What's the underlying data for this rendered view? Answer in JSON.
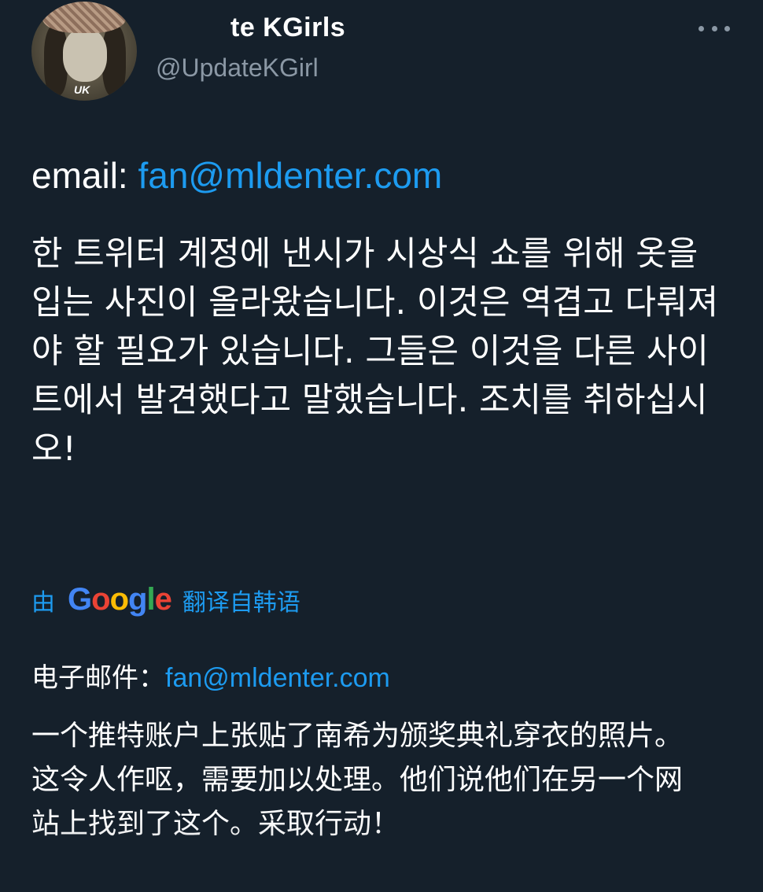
{
  "tweet": {
    "display_name": "te KGirls",
    "handle": "@UpdateKGirl",
    "avatar_mark": "UK",
    "more_icon": "more-horizontal-icon",
    "email_label": "email: ",
    "email_address": "fan@mldenter.com",
    "body_korean": "한 트위터 계정에 낸시가 시상식 쇼를 위해 옷을 입는 사진이 올라왔습니다. 이것은 역겹고 다뤄져야 할 필요가 있습니다. 그들은 이것을 다른 사이트에서 발견했다고 말했습니다. 조치를 취하십시오!"
  },
  "translation": {
    "prefix": "由",
    "google": [
      "G",
      "o",
      "o",
      "g",
      "l",
      "e"
    ],
    "suffix": "翻译自韩语",
    "email_label": "电子邮件：",
    "email_address": "fan@mldenter.com",
    "body_chinese": "一个推特账户上张贴了南希为颁奖典礼穿衣的照片。这令人作呕，需要加以处理。他们说他们在另一个网站上找到了这个。采取行动！"
  },
  "colors": {
    "background": "#15202b",
    "link": "#1d9bf0",
    "secondary_text": "#8b98a5"
  }
}
